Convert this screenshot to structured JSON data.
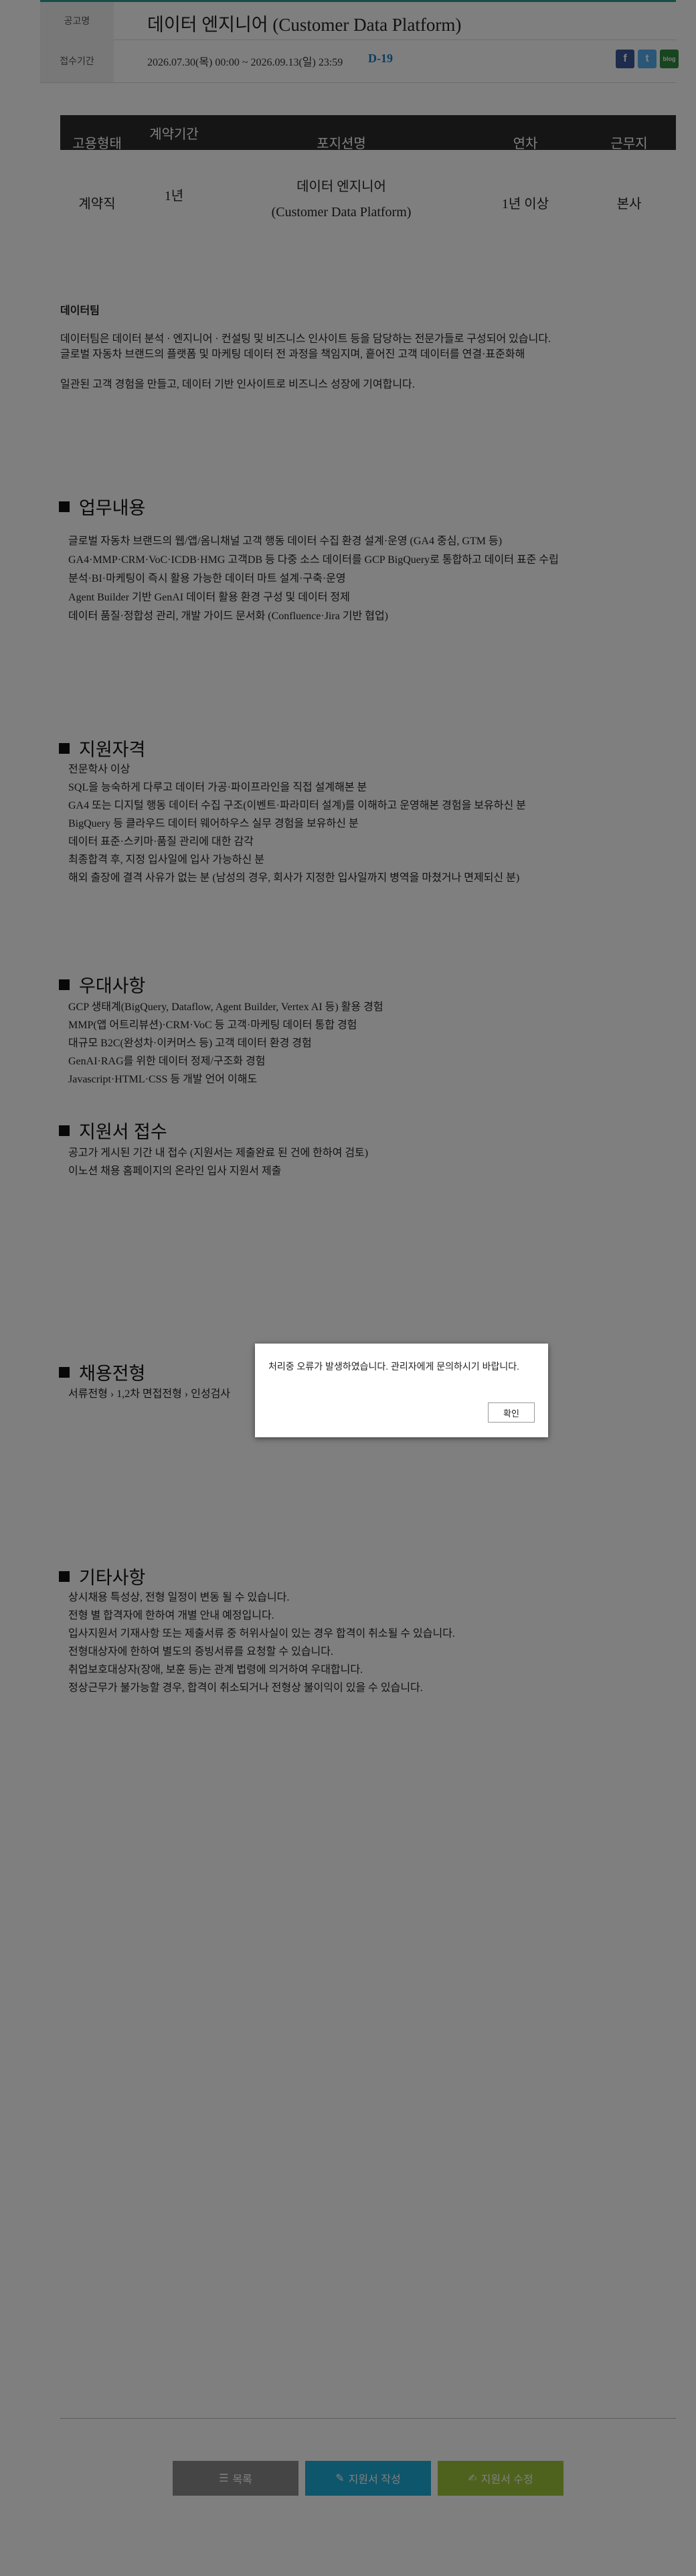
{
  "header": {
    "notice_label": "공고명",
    "notice_title": "데이터 엔지니어 (Customer Data Platform)",
    "period_label": "접수기간",
    "period": "2026.07.30(목) 00:00 ~ 2026.09.13(일) 23:59",
    "dday": "D-19",
    "share": {
      "facebook": "f",
      "twitter": "t",
      "blog": "blog"
    }
  },
  "job_table": {
    "headers": [
      "고용형태",
      "계약기간",
      "포지션명",
      "연차",
      "근무지"
    ],
    "row": {
      "type": "계약직",
      "period": "1년",
      "position_line1": "데이터 엔지니어",
      "position_line2": "(Customer Data Platform)",
      "years": "1년 이상",
      "location": "본사"
    }
  },
  "intro": {
    "team": "데이터팀",
    "p1_l1": "데이터팀은 데이터 분석 · 엔지니어 · 컨설팅 및 비즈니스 인사이트 등을 담당하는 전문가들로 구성되어 있습니다.",
    "p1_l2": "글로벌 자동차 브랜드의 플랫폼 및 마케팅 데이터 전 과정을 책임지며, 흩어진 고객 데이터를 연결·표준화해",
    "p2": "일관된 고객 경험을 만들고, 데이터 기반 인사이트로 비즈니스 성장에 기여합니다."
  },
  "sections": {
    "duties": {
      "title": "업무내용",
      "items": [
        "글로벌 자동차 브랜드의 웹/앱/옴니채널 고객 행동 데이터 수집 환경 설계·운영 (GA4 중심, GTM 등)",
        "GA4·MMP·CRM·VoC·ICDB·HMG 고객DB 등 다중 소스 데이터를 GCP BigQuery로 통합하고 데이터 표준 수립",
        "분석·BI·마케팅이 즉시 활용 가능한 데이터 마트 설계·구축·운영",
        "Agent Builder 기반 GenAI 데이터 활용 환경 구성 및 데이터 정제",
        "데이터 품질·정합성 관리, 개발 가이드 문서화 (Confluence·Jira 기반 협업)"
      ]
    },
    "qualifications": {
      "title": "지원자격",
      "items": [
        "전문학사 이상",
        "SQL을 능숙하게 다루고 데이터 가공·파이프라인을 직접 설계해본 분",
        "GA4 또는 디지털 행동 데이터 수집 구조(이벤트·파라미터 설계)를 이해하고 운영해본 경험을 보유하신 분",
        "BigQuery 등 클라우드 데이터 웨어하우스 실무 경험을 보유하신 분",
        "데이터 표준·스키마·품질 관리에 대한 감각",
        "최종합격 후, 지정 입사일에 입사 가능하신 분",
        "해외 출장에 결격 사유가 없는 분 (남성의 경우, 회사가 지정한 입사일까지 병역을 마쳤거나 면제되신 분)"
      ]
    },
    "preferred": {
      "title": "우대사항",
      "items": [
        "GCP 생태계(BigQuery, Dataflow, Agent Builder, Vertex AI 등) 활용 경험",
        "MMP(앱 어트리뷰션)·CRM·VoC 등 고객·마케팅 데이터 통합 경험",
        "대규모 B2C(완성차·이커머스 등) 고객 데이터 환경 경험",
        "GenAI·RAG를 위한 데이터 정제/구조화 경험",
        "Javascript·HTML·CSS 등 개발 언어 이해도"
      ]
    },
    "application": {
      "title": "지원서 접수",
      "items": [
        "공고가 게시된 기간 내 접수 (지원서는 제출완료 된 건에 한하여 검토)",
        "이노션 채용 홈페이지의 온라인 입사 지원서 제출"
      ]
    },
    "process": {
      "title": "채용전형",
      "items": [
        "서류전형  ›  1,2차 면접전형  ›  인성검사"
      ]
    },
    "etc": {
      "title": "기타사항",
      "items": [
        "상시채용 특성상, 전형 일정이 변동 될 수 있습니다.",
        "전형 별 합격자에 한하여 개별 안내 예정입니다.",
        "입사지원서 기재사항 또는 제출서류 중 허위사실이 있는 경우 합격이 취소될 수 있습니다.",
        "전형대상자에 한하여 별도의 증빙서류를 요청할 수 있습니다.",
        "취업보호대상자(장애, 보훈 등)는 관계 법령에 의거하여 우대합니다.",
        "정상근무가 불가능할 경우, 합격이 취소되거나 전형상 불이익이 있을 수 있습니다."
      ]
    }
  },
  "dialog": {
    "message": "처리중 오류가 발생하였습니다. 관리자에게 문의하시기 바랍니다.",
    "ok_label": "확인"
  },
  "footer": {
    "list_label": "목록",
    "apply_label": "지원서 작성",
    "edit_label": "지원서 수정"
  }
}
